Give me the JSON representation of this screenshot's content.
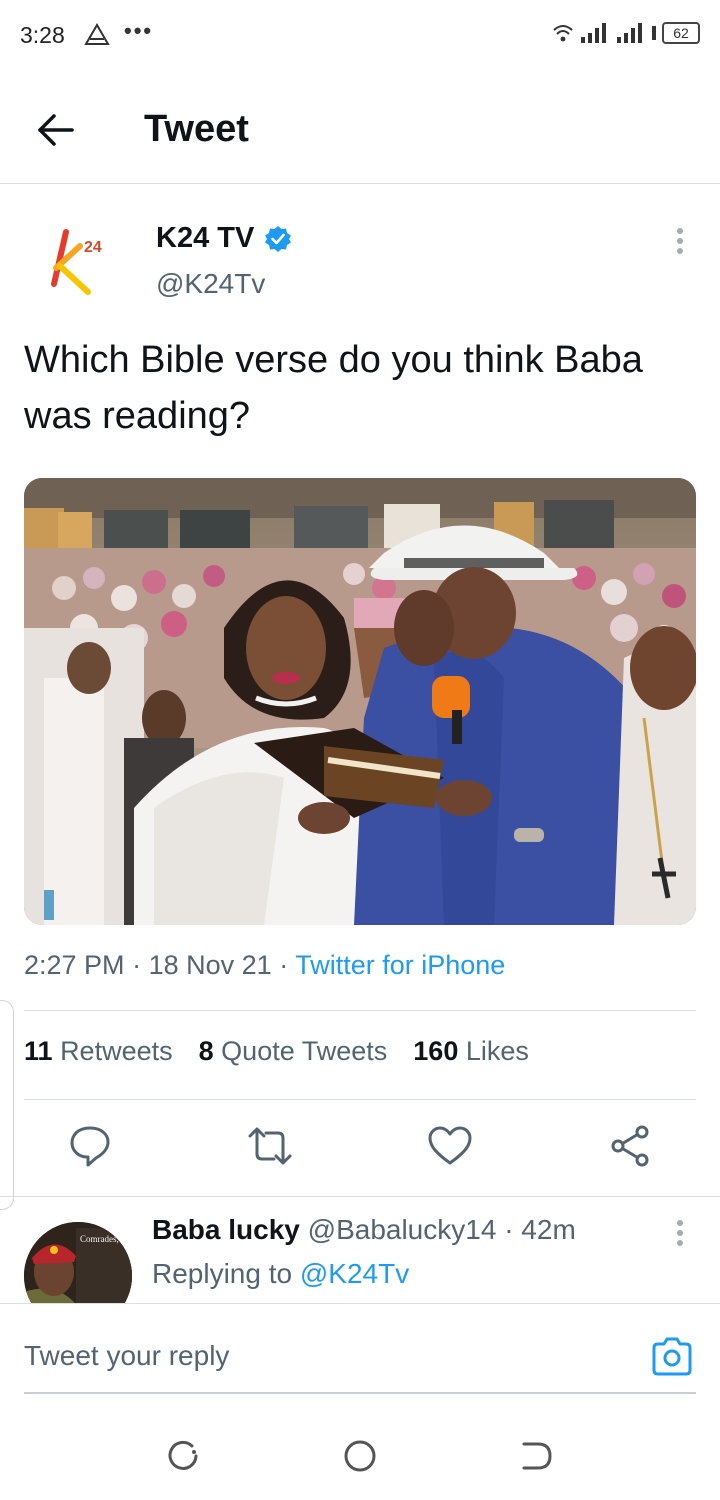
{
  "status_bar": {
    "time": "3:28",
    "battery": "62"
  },
  "header": {
    "title": "Tweet"
  },
  "tweet": {
    "author_name": "K24 TV",
    "author_handle": "@K24Tv",
    "text": "Which Bible verse do you think Baba was reading?",
    "time": "2:27 PM",
    "date": "18 Nov 21",
    "source": "Twitter for iPhone",
    "stats": {
      "retweets_count": "11",
      "retweets_label": "Retweets",
      "quotes_count": "8",
      "quotes_label": "Quote Tweets",
      "likes_count": "160",
      "likes_label": "Likes"
    },
    "avatar_logo_text": "24"
  },
  "reply": {
    "name": "Baba lucky",
    "handle": "@Babalucky14",
    "age": "42m",
    "replying_prefix": "Replying to",
    "replying_to": "@K24Tv",
    "avatar_text": "Comrades, no true sc revolutio without the liberation of women"
  },
  "compose": {
    "placeholder": "Tweet your reply"
  },
  "colors": {
    "accent": "#1d9bf0",
    "text_primary": "#0f1419",
    "text_secondary": "#536471"
  },
  "icons": {
    "back": "arrow-left-icon",
    "verified": "verified-badge-icon",
    "more": "vertical-dots-icon",
    "reply": "comment-bubble-icon",
    "retweet": "retweet-icon",
    "like": "heart-icon",
    "share": "share-icon",
    "camera": "camera-icon"
  }
}
